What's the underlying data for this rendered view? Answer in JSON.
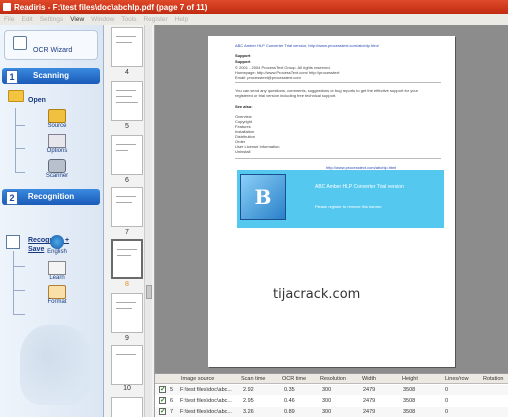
{
  "window": {
    "title": "Readiris - F:\\test files\\doc\\abchlp.pdf (page 7 of 11)"
  },
  "menu": {
    "items": [
      "File",
      "Edit",
      "Settings",
      "View",
      "Window",
      "Tools",
      "Register",
      "Help"
    ],
    "active": "View"
  },
  "sidebar": {
    "ocr_wizard": "OCR Wizard",
    "scanning": {
      "num": "1",
      "title": "Scanning",
      "open": "Open",
      "tools": [
        "Source",
        "Options",
        "Scanner"
      ]
    },
    "recognition": {
      "num": "2",
      "title": "Recognition",
      "action": "Recognize + Save",
      "tools": [
        "English",
        "Learn",
        "Format"
      ]
    }
  },
  "thumbnails": {
    "labels": [
      "4",
      "5",
      "6",
      "7",
      "8",
      "9",
      "10"
    ],
    "selected": "8"
  },
  "document": {
    "header": "ABC Amber HLP Converter Trial version, http://www.processtext.com/abchlp.html",
    "support_title": "Support",
    "support_sub": "Support",
    "copyright": "© 2001 - 2004 ProcessText Group. All rights reserved.",
    "homepage": "Homepage: http://www.ProcessText.com/ http://processtext",
    "email": "Email: processtext@processtext.com",
    "body": "You can send any questions, comments, suggestions or bug reports to get the effective support for your registered or trial version including free technical support.",
    "see_also": "See also:",
    "links": [
      "Overview",
      "Copyright",
      "Features",
      "Installation",
      "Distribution",
      "Order",
      "User License Information",
      "Uninstall"
    ],
    "banner": {
      "logo": "B",
      "title": "ABC Amber HLP Converter Trial version",
      "sub": "Please register to remove this banner.",
      "url": "http://www.processtext.com/abchlp.html"
    }
  },
  "watermark": "tijacrack.com",
  "table": {
    "columns": [
      "",
      "Image source",
      "Scan time",
      "OCR time",
      "Resolution",
      "Width",
      "Height",
      "Lines/row",
      "Rotation"
    ],
    "rows": [
      {
        "num": "5",
        "source": "F:\\test files\\doc\\abc...",
        "scan": "2.92",
        "ocr": "0.35",
        "res": "300",
        "width": "2479",
        "height": "3508",
        "lines": "0",
        "rot": ""
      },
      {
        "num": "6",
        "source": "F:\\test files\\doc\\abc...",
        "scan": "2.95",
        "ocr": "0.46",
        "res": "300",
        "width": "2479",
        "height": "3508",
        "lines": "0",
        "rot": ""
      },
      {
        "num": "7",
        "source": "F:\\test files\\doc\\abc...",
        "scan": "3.26",
        "ocr": "0.89",
        "res": "300",
        "width": "2479",
        "height": "3508",
        "lines": "0",
        "rot": ""
      }
    ]
  }
}
